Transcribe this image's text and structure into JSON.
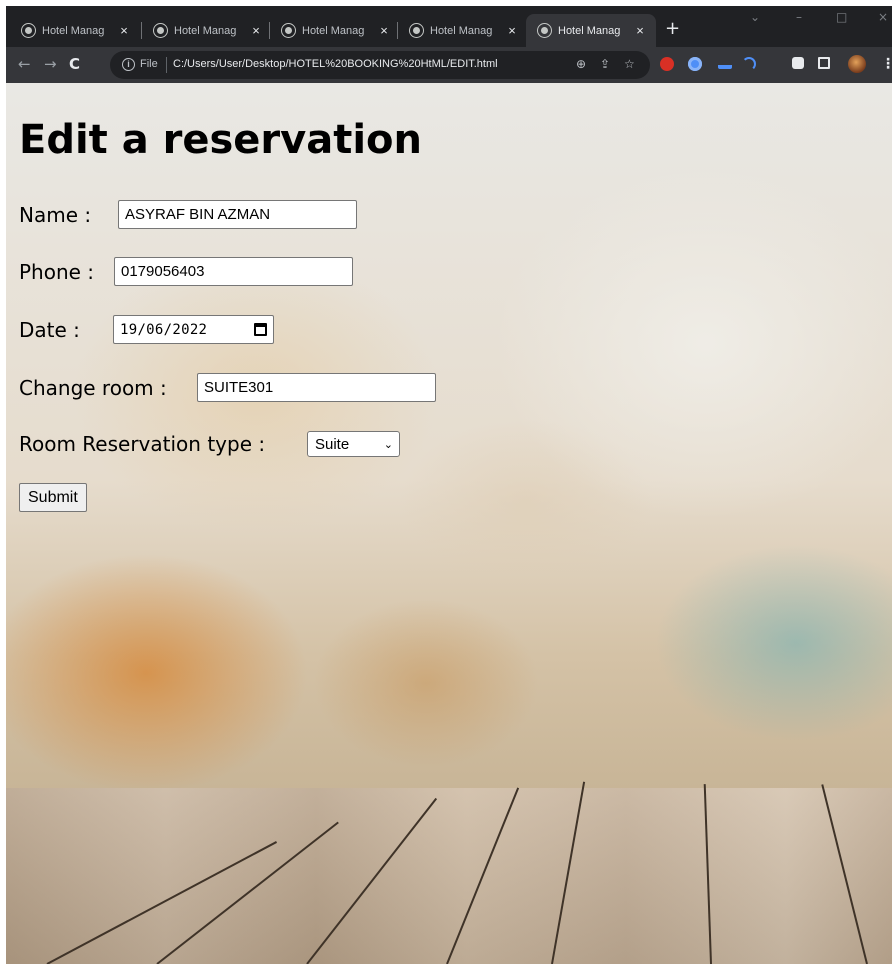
{
  "browser": {
    "tabs": [
      {
        "title": "Hotel Manag",
        "active": false
      },
      {
        "title": "Hotel Manag",
        "active": false
      },
      {
        "title": "Hotel Manag",
        "active": false
      },
      {
        "title": "Hotel Manag",
        "active": false
      },
      {
        "title": "Hotel Manag",
        "active": true
      }
    ],
    "tab_close_glyph": "×",
    "new_tab_glyph": "+",
    "window_controls": {
      "dropdown": "⌄",
      "minimize": "–",
      "maximize": "□",
      "close": "×"
    },
    "nav": {
      "back": "←",
      "forward": "→",
      "reload": "C"
    },
    "address": {
      "info": "i",
      "scheme_label": "File",
      "url": "C:/Users/User/Desktop/HOTEL%20BOOKING%20HtML/EDIT.html"
    },
    "omnibox_icons": [
      "zoom-icon",
      "share-icon",
      "star-icon"
    ],
    "extensions": [
      "red-shield-extension-icon",
      "blue-search-extension-icon",
      "pen-extension-icon",
      "audio-extension-icon",
      "puzzle-extensions-icon",
      "sidepanel-icon",
      "profile-avatar-icon"
    ],
    "menu_glyph": "⋮"
  },
  "page": {
    "heading": "Edit a reservation",
    "form": {
      "name": {
        "label": "Name  :",
        "value": "ASYRAF BIN AZMAN"
      },
      "phone": {
        "label": "Phone :",
        "value": "0179056403"
      },
      "date": {
        "label": "Date   :",
        "value": "19/06/2022"
      },
      "room": {
        "label": "Change room :",
        "value": "SUITE301"
      },
      "type": {
        "label": "Room Reservation type :",
        "value": "Suite",
        "chevron": "⌄"
      },
      "submit_label": "Submit"
    }
  },
  "colors": {
    "tabstrip": "#202124",
    "toolbar": "#35363a",
    "omnibox": "#202124"
  }
}
